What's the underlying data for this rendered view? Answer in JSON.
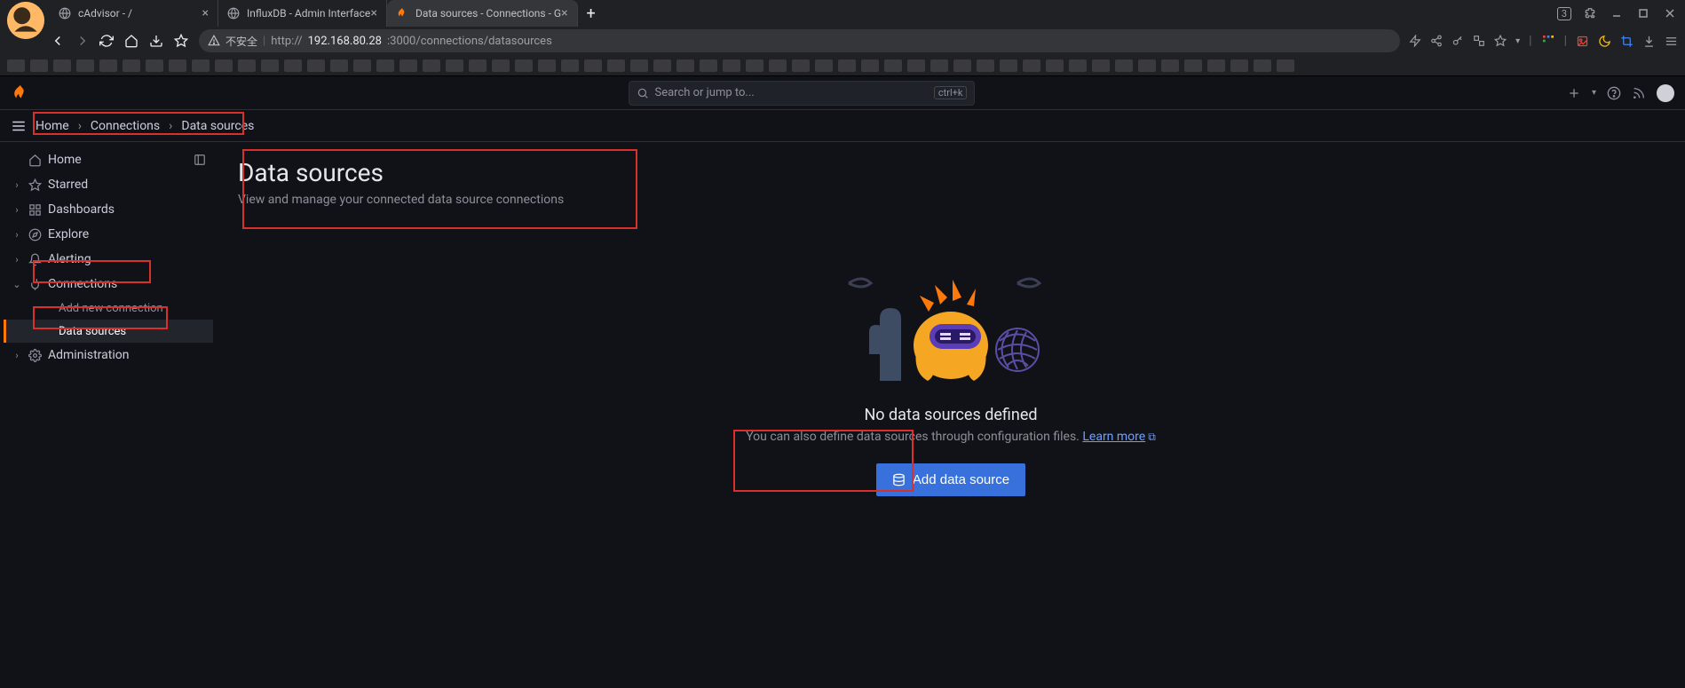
{
  "browser": {
    "tabs": [
      {
        "title": "cAdvisor - /",
        "active": false
      },
      {
        "title": "InfluxDB - Admin Interface",
        "active": false
      },
      {
        "title": "Data sources - Connections - G",
        "active": true
      }
    ],
    "tab_count_badge": "3",
    "insecure_label": "不安全",
    "url_prefix": "http://",
    "url_host": "192.168.80.28",
    "url_port_path": ":3000/connections/datasources"
  },
  "app": {
    "search_placeholder": "Search or jump to...",
    "search_kbd": "ctrl+k",
    "breadcrumbs": [
      "Home",
      "Connections",
      "Data sources"
    ],
    "sidebar": {
      "items": [
        {
          "label": "Home",
          "icon": "home"
        },
        {
          "label": "Starred",
          "icon": "star"
        },
        {
          "label": "Dashboards",
          "icon": "grid"
        },
        {
          "label": "Explore",
          "icon": "compass"
        },
        {
          "label": "Alerting",
          "icon": "bell"
        },
        {
          "label": "Connections",
          "icon": "plug",
          "expanded": true
        },
        {
          "label": "Administration",
          "icon": "gear"
        }
      ],
      "connections_sub": [
        {
          "label": "Add new connection",
          "active": false
        },
        {
          "label": "Data sources",
          "active": true
        }
      ]
    },
    "page": {
      "title": "Data sources",
      "subtitle": "View and manage your connected data source connections"
    },
    "empty": {
      "title": "No data sources defined",
      "subtitle_pre": "You can also define data sources through configuration files. ",
      "learn_more": "Learn more",
      "button": "Add data source"
    }
  }
}
